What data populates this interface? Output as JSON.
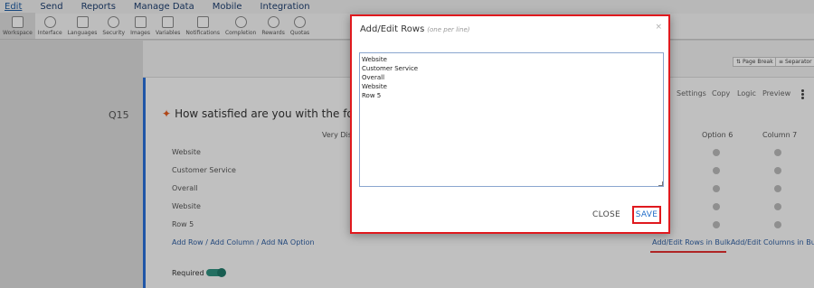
{
  "menu": [
    {
      "label": "Edit"
    },
    {
      "label": "Send"
    },
    {
      "label": "Reports"
    },
    {
      "label": "Manage Data"
    },
    {
      "label": "Mobile"
    },
    {
      "label": "Integration"
    }
  ],
  "toolbar": [
    {
      "label": "Workspace",
      "icon": "workspace-icon"
    },
    {
      "label": "Interface",
      "icon": "interface-icon"
    },
    {
      "label": "Languages",
      "icon": "languages-icon"
    },
    {
      "label": "Security",
      "icon": "security-icon"
    },
    {
      "label": "Images",
      "icon": "images-icon"
    },
    {
      "label": "Variables",
      "icon": "variables-icon"
    },
    {
      "label": "Notifications",
      "icon": "notifications-icon"
    },
    {
      "label": "Completion",
      "icon": "completion-icon"
    },
    {
      "label": "Rewards",
      "icon": "rewards-icon"
    },
    {
      "label": "Quotas",
      "icon": "quotas-icon"
    }
  ],
  "page_break": "Page Break",
  "separator": "Separator",
  "question": {
    "number": "Q15",
    "text": "How satisfied are you with the followings",
    "actions": [
      "Settings",
      "Copy",
      "Logic",
      "Preview"
    ],
    "columns": [
      "Very Dis",
      "Option 6",
      "Column 7"
    ],
    "rows": [
      "Website",
      "Customer Service",
      "Overall",
      "Website",
      "Row 5"
    ],
    "add_links": "Add Row / Add Column / Add NA Option",
    "bulk_links": "Add/Edit Rows in BulkAdd/Edit Columns in Bulk",
    "required_label": "Required"
  },
  "modal": {
    "title": "Add/Edit Rows",
    "subtitle": "(one per line)",
    "close_x": "×",
    "rows_text": "Website\nCustomer Service\nOverall\nWebsite\nRow 5",
    "close_label": "CLOSE",
    "save_label": "SAVE"
  }
}
